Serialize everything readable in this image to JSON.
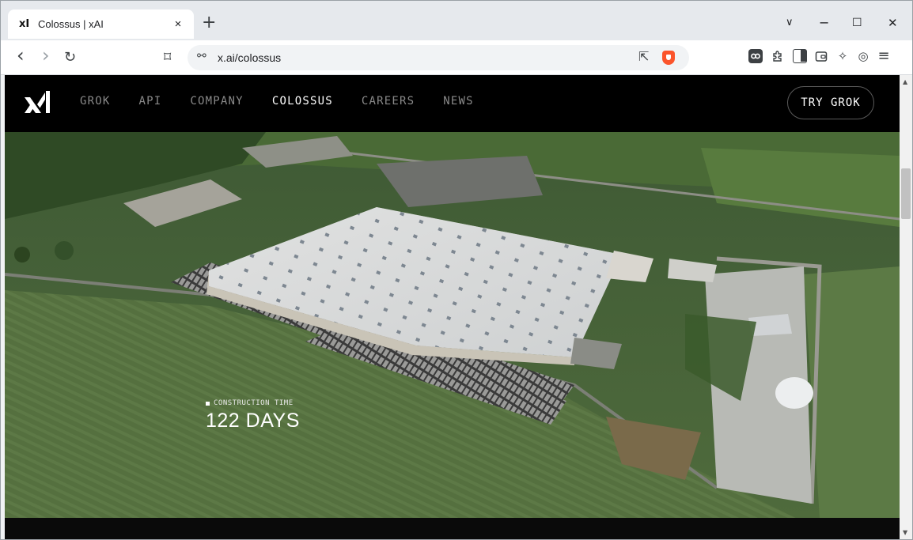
{
  "browser": {
    "tab": {
      "title": "Colossus | xAI",
      "favicon": "xI",
      "close": "×"
    },
    "new_tab": "+",
    "window_controls": {
      "dropdown": "∨",
      "minimize": "−",
      "maximize": "☐",
      "close": "✕"
    },
    "nav": {
      "back": "‹",
      "forward": "›",
      "reload": "↻",
      "bookmark": "⌑"
    },
    "url": "x.ai/colossus",
    "icons": {
      "tune": "⚯",
      "share": "⇱",
      "extensions": "⚙",
      "wallet": "▭",
      "leo": "✧",
      "vpn": "◎",
      "menu": "≡"
    }
  },
  "site": {
    "nav_items": [
      {
        "label": "GROK",
        "active": false
      },
      {
        "label": "API",
        "active": false
      },
      {
        "label": "COMPANY",
        "active": false
      },
      {
        "label": "COLOSSUS",
        "active": true
      },
      {
        "label": "CAREERS",
        "active": false
      },
      {
        "label": "NEWS",
        "active": false
      }
    ],
    "cta": "TRY GROK",
    "stat": {
      "label": "CONSTRUCTION TIME",
      "value": "122 DAYS"
    }
  },
  "scrollbar": {
    "up": "▲",
    "down": "▼"
  }
}
